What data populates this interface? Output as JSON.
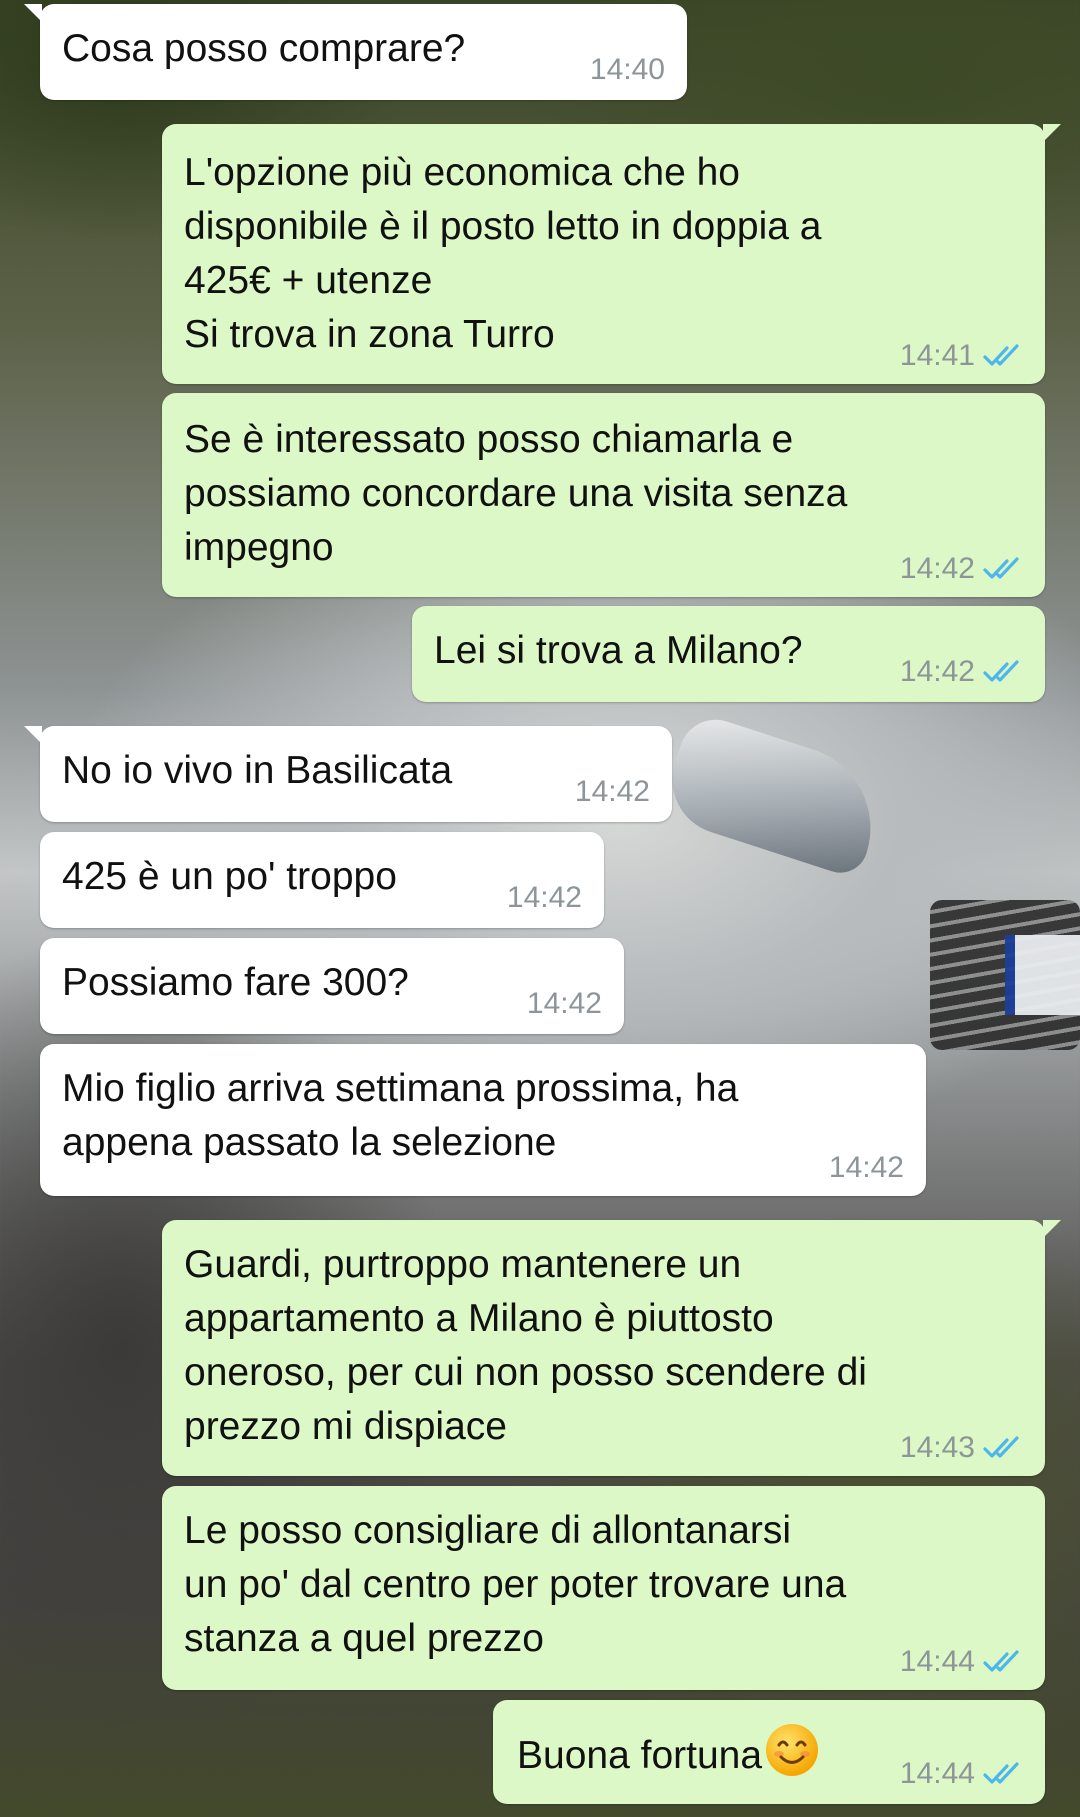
{
  "chat": {
    "messages": [
      {
        "id": 1,
        "direction": "in",
        "text": "Cosa posso comprare?",
        "time": "14:40"
      },
      {
        "id": 2,
        "direction": "out",
        "text": "L'opzione più economica che ho\ndisponibile è il posto letto in doppia a\n425€ + utenze\nSi trova in zona Turro",
        "time": "14:41",
        "status": "read"
      },
      {
        "id": 3,
        "direction": "out",
        "text": "Se è interessato posso chiamarla e\npossiamo concordare una visita senza\nimpegno",
        "time": "14:42",
        "status": "read"
      },
      {
        "id": 4,
        "direction": "out",
        "text": "Lei si trova a Milano?",
        "time": "14:42",
        "status": "read"
      },
      {
        "id": 5,
        "direction": "in",
        "text": "No io vivo in Basilicata",
        "time": "14:42"
      },
      {
        "id": 6,
        "direction": "in",
        "text": "425 è un po' troppo",
        "time": "14:42"
      },
      {
        "id": 7,
        "direction": "in",
        "text": "Possiamo fare 300?",
        "time": "14:42"
      },
      {
        "id": 8,
        "direction": "in",
        "text": "Mio figlio arriva settimana prossima, ha\nappena passato la selezione",
        "time": "14:42"
      },
      {
        "id": 9,
        "direction": "out",
        "text": "Guardi, purtroppo mantenere un\nappartamento a Milano è piuttosto\noneroso, per cui non posso scendere di\nprezzo mi dispiace",
        "time": "14:43",
        "status": "read"
      },
      {
        "id": 10,
        "direction": "out",
        "text": "Le posso consigliare di allontanarsi\nun po' dal centro per poter trovare una\nstanza a quel prezzo",
        "time": "14:44",
        "status": "read"
      },
      {
        "id": 11,
        "direction": "out",
        "text": "Buona fortuna",
        "emoji": "smiling-face-emoji",
        "time": "14:44",
        "status": "read"
      }
    ]
  },
  "colors": {
    "incoming_bubble": "#ffffff",
    "outgoing_bubble": "#dcf8c6",
    "read_ticks": "#4fb6ec",
    "timestamp": "#8d9599"
  }
}
